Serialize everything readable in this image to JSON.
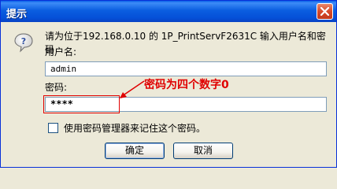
{
  "window": {
    "title": "提示"
  },
  "dialog": {
    "prompt": "请为位于192.168.0.10 的 1P_PrintServF2631C 输入用户名和密码",
    "username_label": "用户名:",
    "username_value": "admin",
    "password_label": "密码:",
    "password_value": "****",
    "remember_label": "使用密码管理器来记住这个密码。",
    "remember_checked": false
  },
  "annotation": {
    "text": "密码为四个数字0",
    "color": "#e00000"
  },
  "buttons": {
    "ok_label": "确定",
    "cancel_label": "取消"
  },
  "colors": {
    "titlebar": "#0b5ee0",
    "dialog_bg": "#ece9d8",
    "annotation": "#e00000"
  }
}
